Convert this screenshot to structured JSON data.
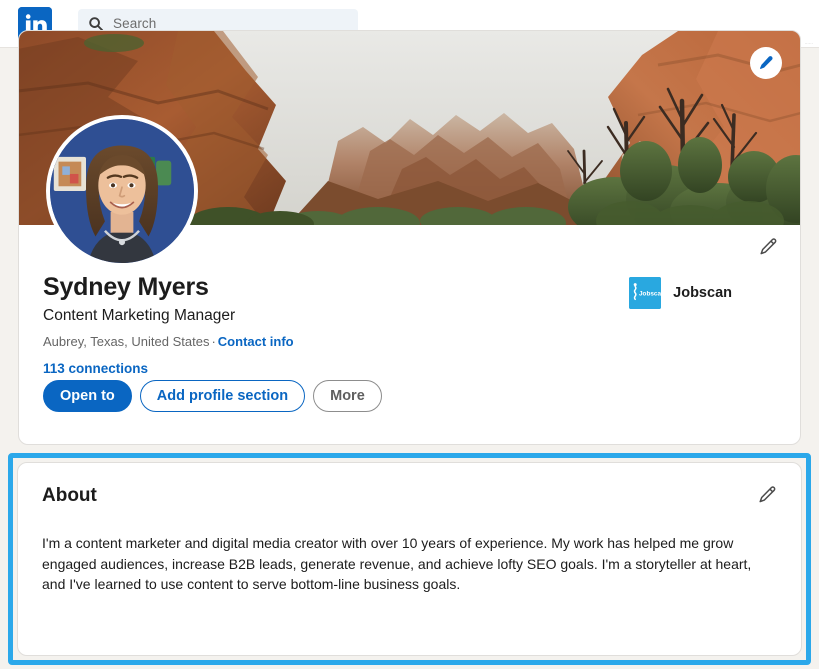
{
  "nav": {
    "logo_icon": "linkedin-logo",
    "search": {
      "icon": "search-icon",
      "placeholder": "Search",
      "value": ""
    },
    "ghost_items": [
      "...",
      "......",
      "......"
    ]
  },
  "profile": {
    "cover_edit_icon": "pencil-icon",
    "avatar_alt": "profile-photo",
    "edit_icon": "pencil-icon",
    "name": "Sydney Myers",
    "headline": "Content Marketing Manager",
    "location": "Aubrey, Texas, United States",
    "separator": "·",
    "contact_info_label": "Contact info",
    "connections": "113 connections",
    "company": {
      "logo_text": "Jobscan",
      "name": "Jobscan"
    },
    "buttons": [
      {
        "label": "Open to",
        "style": "primary",
        "name": "open-to-button"
      },
      {
        "label": "Add profile section",
        "style": "outline-blue",
        "name": "add-profile-section-button"
      },
      {
        "label": "More",
        "style": "outline-gray",
        "name": "more-button"
      }
    ]
  },
  "about": {
    "title": "About",
    "edit_icon": "pencil-icon",
    "text": "I'm a content marketer and digital media creator with over 10 years of experience. My work has helped me grow engaged audiences, increase B2B leads, generate revenue, and achieve lofty SEO goals. I'm a storyteller at heart, and I've learned to use content to serve bottom-line business goals.",
    "highlighted": true
  },
  "colors": {
    "brand_blue": "#0a66c2",
    "highlight_blue": "#2ba8ea",
    "page_background": "#f4f2ee",
    "card_background": "#ffffff",
    "company_logo_blue": "#29a8e0",
    "search_background": "#eef3f8"
  }
}
